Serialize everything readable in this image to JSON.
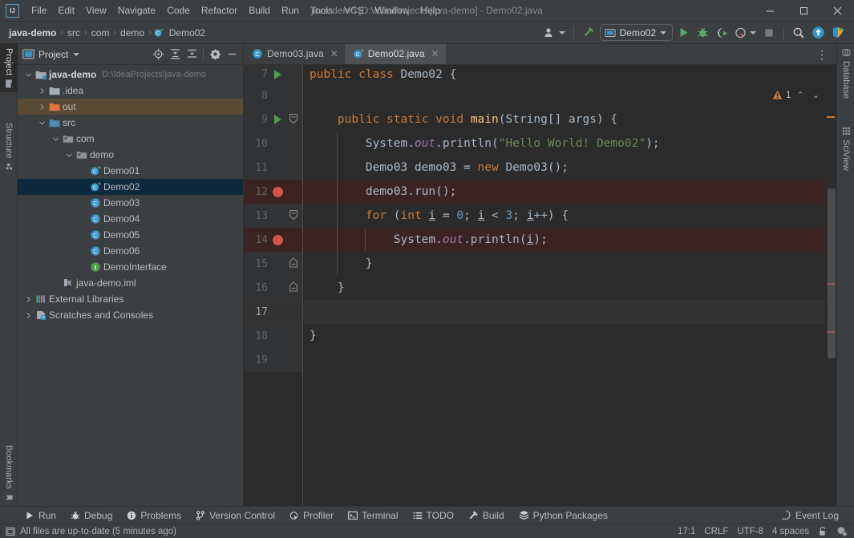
{
  "window": {
    "title": "java-demo [D:\\IdeaProjects\\java-demo] - Demo02.java",
    "minimize_label": "—",
    "maximize_label": "☐",
    "close_label": "✕",
    "logo_label": "IJ"
  },
  "menu": {
    "items": [
      "File",
      "Edit",
      "View",
      "Navigate",
      "Code",
      "Refactor",
      "Build",
      "Run",
      "Tools",
      "VCS",
      "Window",
      "Help"
    ]
  },
  "breadcrumbs": {
    "separator": "›",
    "items": [
      {
        "label": "java-demo",
        "icon": "",
        "root": true
      },
      {
        "label": "src",
        "icon": ""
      },
      {
        "label": "com",
        "icon": ""
      },
      {
        "label": "demo",
        "icon": ""
      },
      {
        "label": "Demo02",
        "icon": "java-class-icon"
      }
    ]
  },
  "toolbar": {
    "account_label": "",
    "account_icon": "user-avatar-icon",
    "update_icon": "hammer-update-icon",
    "run_config": {
      "name": "Demo02",
      "icon": "run-config-icon"
    },
    "run_icon": "run-icon",
    "debug_icon": "debug-icon",
    "run_coverage_icon": "run-with-coverage-icon",
    "profiler_icon": "profiler-icon",
    "stop_icon": "stop-icon",
    "search_icon": "search-everywhere-icon",
    "updates_icon": "updates-available-icon",
    "feedback_icon": "ide-feedback-icon"
  },
  "left_strip": {
    "tabs": [
      {
        "label": "Project",
        "icon": "project-folder-icon",
        "active": true
      },
      {
        "label": "Structure",
        "icon": "structure-icon",
        "active": false
      },
      {
        "label": "Bookmarks",
        "icon": "bookmarks-icon",
        "active": false
      }
    ]
  },
  "right_strip": {
    "tabs": [
      {
        "label": "Database",
        "icon": "database-icon"
      },
      {
        "label": "SciView",
        "icon": "sciview-icon"
      }
    ]
  },
  "project_panel": {
    "title": "Project",
    "dropdown_icon": "chevron-down-icon",
    "tools": [
      {
        "name": "select-opened-file-icon",
        "title": "Select Opened File"
      },
      {
        "name": "expand-all-icon",
        "title": "Expand All"
      },
      {
        "name": "collapse-all-icon",
        "title": "Collapse All"
      },
      {
        "name": "settings-gear-icon",
        "title": "Options"
      },
      {
        "name": "hide-panel-icon",
        "title": "Hide"
      }
    ],
    "tree": [
      {
        "label": "java-demo",
        "path": "D:\\IdeaProjects\\java-demo",
        "indent": 0,
        "twist": "expanded",
        "icon": "project-module-icon",
        "bold": true,
        "state": "normal"
      },
      {
        "label": ".idea",
        "path": "",
        "indent": 1,
        "twist": "collapsed",
        "icon": "folder-icon",
        "bold": false,
        "state": "normal"
      },
      {
        "label": "out",
        "path": "",
        "indent": 1,
        "twist": "collapsed",
        "icon": "folder-excluded-icon",
        "bold": false,
        "state": "highlight"
      },
      {
        "label": "src",
        "path": "",
        "indent": 1,
        "twist": "expanded",
        "icon": "folder-source-icon",
        "bold": false,
        "state": "normal"
      },
      {
        "label": "com",
        "path": "",
        "indent": 2,
        "twist": "expanded",
        "icon": "package-icon",
        "bold": false,
        "state": "normal"
      },
      {
        "label": "demo",
        "path": "",
        "indent": 3,
        "twist": "expanded",
        "icon": "package-icon",
        "bold": false,
        "state": "normal"
      },
      {
        "label": "Demo01",
        "path": "",
        "indent": 4,
        "twist": "none",
        "icon": "java-class-runnable-icon",
        "bold": false,
        "state": "normal"
      },
      {
        "label": "Demo02",
        "path": "",
        "indent": 4,
        "twist": "none",
        "icon": "java-class-runnable-icon",
        "bold": false,
        "state": "selected"
      },
      {
        "label": "Demo03",
        "path": "",
        "indent": 4,
        "twist": "none",
        "icon": "java-class-icon",
        "bold": false,
        "state": "normal"
      },
      {
        "label": "Demo04",
        "path": "",
        "indent": 4,
        "twist": "none",
        "icon": "java-class-icon",
        "bold": false,
        "state": "normal"
      },
      {
        "label": "Demo05",
        "path": "",
        "indent": 4,
        "twist": "none",
        "icon": "java-class-icon",
        "bold": false,
        "state": "normal"
      },
      {
        "label": "Demo06",
        "path": "",
        "indent": 4,
        "twist": "none",
        "icon": "java-class-icon",
        "bold": false,
        "state": "normal"
      },
      {
        "label": "DemoInterface",
        "path": "",
        "indent": 4,
        "twist": "none",
        "icon": "java-interface-icon",
        "bold": false,
        "state": "normal"
      },
      {
        "label": "java-demo.iml",
        "path": "",
        "indent": 2,
        "twist": "none",
        "icon": "iml-file-icon",
        "bold": false,
        "state": "normal"
      },
      {
        "label": "External Libraries",
        "path": "",
        "indent": 0,
        "twist": "collapsed",
        "icon": "libraries-icon",
        "bold": false,
        "state": "normal"
      },
      {
        "label": "Scratches and Consoles",
        "path": "",
        "indent": 0,
        "twist": "collapsed",
        "icon": "scratches-icon",
        "bold": false,
        "state": "normal"
      }
    ]
  },
  "editor": {
    "tabs": [
      {
        "label": "Demo03.java",
        "icon": "java-class-icon",
        "active": false,
        "close": "✕"
      },
      {
        "label": "Demo02.java",
        "icon": "java-class-runnable-icon",
        "active": true,
        "close": "✕"
      }
    ],
    "kebab_icon": "more-options-icon",
    "inspection": {
      "count": "1",
      "icon": "warning-triangle-icon",
      "prev": "⌃",
      "next": "⌄"
    },
    "lines": [
      {
        "num": "7",
        "gutter": "run",
        "fold": "",
        "bp": false,
        "current": false,
        "indent_guides": [],
        "tokens": [
          {
            "t": "public",
            "c": "k"
          },
          {
            "t": " ",
            "c": "t"
          },
          {
            "t": "class",
            "c": "k"
          },
          {
            "t": " Demo02 {",
            "c": "t"
          }
        ]
      },
      {
        "num": "8",
        "gutter": "",
        "fold": "",
        "bp": false,
        "current": false,
        "indent_guides": [],
        "tokens": []
      },
      {
        "num": "9",
        "gutter": "run",
        "fold": "start",
        "bp": false,
        "current": false,
        "indent_guides": [],
        "tokens": [
          {
            "t": "    ",
            "c": "t"
          },
          {
            "t": "public",
            "c": "k"
          },
          {
            "t": " ",
            "c": "t"
          },
          {
            "t": "static",
            "c": "k"
          },
          {
            "t": " ",
            "c": "t"
          },
          {
            "t": "void",
            "c": "k"
          },
          {
            "t": " ",
            "c": "t"
          },
          {
            "t": "main",
            "c": "f"
          },
          {
            "t": "(String[] args) {",
            "c": "t"
          }
        ]
      },
      {
        "num": "10",
        "gutter": "",
        "fold": "",
        "bp": false,
        "current": false,
        "indent_guides": [
          1
        ],
        "tokens": [
          {
            "t": "        System.",
            "c": "t"
          },
          {
            "t": "out",
            "c": "st"
          },
          {
            "t": ".println(",
            "c": "t"
          },
          {
            "t": "\"Hello World! Demo02\"",
            "c": "s"
          },
          {
            "t": ");",
            "c": "t"
          }
        ]
      },
      {
        "num": "11",
        "gutter": "",
        "fold": "",
        "bp": false,
        "current": false,
        "indent_guides": [
          1
        ],
        "tokens": [
          {
            "t": "        Demo03 demo03 = ",
            "c": "t"
          },
          {
            "t": "new",
            "c": "k"
          },
          {
            "t": " Demo03();",
            "c": "t"
          }
        ]
      },
      {
        "num": "12",
        "gutter": "breakpoint",
        "fold": "",
        "bp": true,
        "current": false,
        "indent_guides": [
          1
        ],
        "tokens": [
          {
            "t": "        demo03.run();",
            "c": "t"
          }
        ]
      },
      {
        "num": "13",
        "gutter": "",
        "fold": "start",
        "bp": false,
        "current": false,
        "indent_guides": [
          1
        ],
        "tokens": [
          {
            "t": "        ",
            "c": "t"
          },
          {
            "t": "for",
            "c": "k"
          },
          {
            "t": " (",
            "c": "t"
          },
          {
            "t": "int",
            "c": "k"
          },
          {
            "t": " ",
            "c": "t"
          },
          {
            "t": "i",
            "c": "tu"
          },
          {
            "t": " = ",
            "c": "t"
          },
          {
            "t": "0",
            "c": "n"
          },
          {
            "t": "; ",
            "c": "t"
          },
          {
            "t": "i",
            "c": "tu"
          },
          {
            "t": " < ",
            "c": "t"
          },
          {
            "t": "3",
            "c": "n"
          },
          {
            "t": "; ",
            "c": "t"
          },
          {
            "t": "i",
            "c": "tu"
          },
          {
            "t": "++) {",
            "c": "t"
          }
        ]
      },
      {
        "num": "14",
        "gutter": "breakpoint",
        "fold": "",
        "bp": true,
        "current": false,
        "indent_guides": [
          1,
          2
        ],
        "tokens": [
          {
            "t": "            System.",
            "c": "t"
          },
          {
            "t": "out",
            "c": "st"
          },
          {
            "t": ".println(",
            "c": "t"
          },
          {
            "t": "i",
            "c": "tu"
          },
          {
            "t": ");",
            "c": "t"
          }
        ]
      },
      {
        "num": "15",
        "gutter": "",
        "fold": "end",
        "bp": false,
        "current": false,
        "indent_guides": [
          1
        ],
        "tokens": [
          {
            "t": "        }",
            "c": "t"
          }
        ]
      },
      {
        "num": "16",
        "gutter": "",
        "fold": "end",
        "bp": false,
        "current": false,
        "indent_guides": [],
        "tokens": [
          {
            "t": "    }",
            "c": "t"
          }
        ]
      },
      {
        "num": "17",
        "gutter": "",
        "fold": "",
        "bp": false,
        "current": true,
        "indent_guides": [],
        "tokens": []
      },
      {
        "num": "18",
        "gutter": "",
        "fold": "",
        "bp": false,
        "current": false,
        "indent_guides": [],
        "tokens": [
          {
            "t": "}",
            "c": "t"
          }
        ]
      },
      {
        "num": "19",
        "gutter": "",
        "fold": "",
        "bp": false,
        "current": false,
        "indent_guides": [],
        "tokens": []
      }
    ]
  },
  "bottom_bar": {
    "items": [
      {
        "label": "Run",
        "icon": "run-icon"
      },
      {
        "label": "Debug",
        "icon": "debug-icon"
      },
      {
        "label": "Problems",
        "icon": "problems-icon"
      },
      {
        "label": "Version Control",
        "icon": "version-control-icon"
      },
      {
        "label": "Profiler",
        "icon": "profiler-icon"
      },
      {
        "label": "Terminal",
        "icon": "terminal-icon"
      },
      {
        "label": "TODO",
        "icon": "todo-icon"
      },
      {
        "label": "Build",
        "icon": "build-hammer-icon"
      },
      {
        "label": "Python Packages",
        "icon": "python-packages-icon"
      }
    ],
    "event_log": {
      "label": "Event Log",
      "icon": "event-log-icon"
    }
  },
  "status_bar": {
    "message": "All files are up-to-date (5 minutes ago)",
    "message_icon": "sync-status-icon",
    "caret_position": "17:1",
    "line_separator": "CRLF",
    "encoding": "UTF-8",
    "indent": "4 spaces",
    "lock_icon": "read-write-lock-icon",
    "inspection_icon": "inspection-profile-icon"
  },
  "colors": {
    "bg_chrome": "#3c3f41",
    "bg_editor": "#2b2b2b",
    "gutter": "#313335",
    "accent_selection": "#0d293e",
    "breakpoint": "#d2544a",
    "run_green": "#4b9e4b",
    "warning": "#cc7832",
    "string": "#6a8759",
    "keyword": "#cc7832",
    "number": "#6897bb",
    "text": "#a9b7c6"
  }
}
